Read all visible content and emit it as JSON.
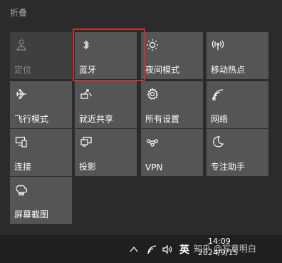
{
  "header": {
    "collapse_label": "折叠"
  },
  "tiles": [
    {
      "label": "定位",
      "icon": "location-icon",
      "state": "off"
    },
    {
      "label": "蓝牙",
      "icon": "bluetooth-icon",
      "state": "on"
    },
    {
      "label": "夜间模式",
      "icon": "brightness-icon",
      "state": "on"
    },
    {
      "label": "移动热点",
      "icon": "hotspot-icon",
      "state": "on"
    },
    {
      "label": "飞行模式",
      "icon": "airplane-icon",
      "state": "on"
    },
    {
      "label": "就近共享",
      "icon": "nearby-share-icon",
      "state": "on"
    },
    {
      "label": "所有设置",
      "icon": "gear-icon",
      "state": "on"
    },
    {
      "label": "网络",
      "icon": "network-icon",
      "state": "on"
    },
    {
      "label": "连接",
      "icon": "connect-icon",
      "state": "on"
    },
    {
      "label": "投影",
      "icon": "project-icon",
      "state": "on"
    },
    {
      "label": "VPN",
      "icon": "vpn-icon",
      "state": "on"
    },
    {
      "label": "专注助手",
      "icon": "moon-icon",
      "state": "on"
    },
    {
      "label": "屏幕截图",
      "icon": "snip-icon",
      "state": "on"
    }
  ],
  "taskbar": {
    "ime_label": "英",
    "time": "14:09",
    "date": "2024/9/15",
    "watermark": "知乎 @写意明白"
  },
  "colors": {
    "highlight": "#d02d2d",
    "tile_bg": "#555555",
    "tile_disabled_bg": "#3f3f3f",
    "panel_bg": "#2b2b2b",
    "taskbar_bg": "#1f1f1f"
  }
}
